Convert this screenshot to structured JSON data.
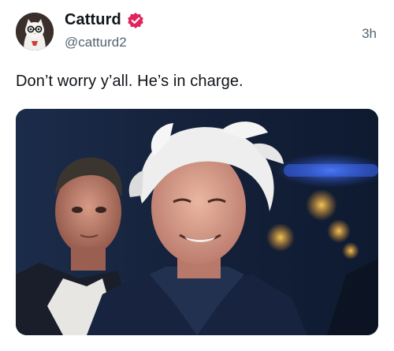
{
  "author": {
    "display_name": "Catturd",
    "handle": "@catturd2",
    "avatar_icon": "cat-avatar-icon",
    "badge_icon": "verified-badge-icon",
    "badge_color": "#e0245e"
  },
  "post": {
    "timestamp": "3h",
    "text": "Don’t worry y’all. He’s in charge."
  },
  "media": {
    "type": "photo",
    "content": "night outdoor photo of a smiling older man with windblown white hair and a man in a suit behind him"
  }
}
